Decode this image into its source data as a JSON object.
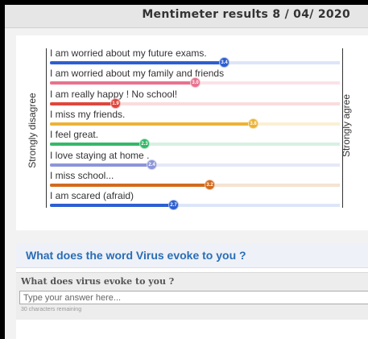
{
  "header": {
    "title": "Mentimeter results 8 / 04/ 2020"
  },
  "scale": {
    "left_label": "Strongly disagree",
    "right_label": "Strongly agree"
  },
  "chart_data": {
    "type": "bar",
    "xlim": [
      1,
      5
    ],
    "scale_labels": [
      "Strongly disagree",
      "Strongly agree"
    ],
    "categories": [
      "I am worried about my future exams.",
      "I am worried about my family and friends",
      "I am really happy ! No school!",
      "I miss my friends.",
      "I feel great.",
      "I love staying at home .",
      "I miss school...",
      "I am scared (afraid)"
    ],
    "values": [
      3.4,
      3.0,
      1.9,
      3.8,
      2.3,
      2.4,
      3.2,
      2.7
    ],
    "value_labels": [
      "3.4",
      "3.0",
      "1.9",
      "3.8",
      "2.3",
      "2.4",
      "3.2",
      "2.7"
    ],
    "colors": [
      "#2d5fd0",
      "#e8728e",
      "#e0463c",
      "#ecb335",
      "#35b86a",
      "#8c96d8",
      "#d26b1e",
      "#2d5fd0"
    ],
    "track_colors": [
      "#dde6f7",
      "#fbe2e8",
      "#f9dddb",
      "#fbf0d3",
      "#d7f1e2",
      "#e6e8f7",
      "#f6e3d2",
      "#dde6f7"
    ]
  },
  "question": {
    "heading": "What does the word Virus evoke to you ?",
    "label": "What does virus evoke to you ?",
    "placeholder": "Type your answer here...",
    "char_count": "30 characters remaining"
  }
}
